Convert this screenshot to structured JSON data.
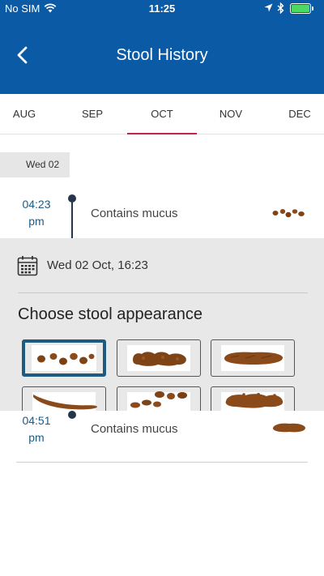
{
  "status": {
    "carrier": "No SIM",
    "time": "11:25"
  },
  "header": {
    "title": "Stool History"
  },
  "tabs": [
    {
      "label": "AUG"
    },
    {
      "label": "SEP"
    },
    {
      "label": "OCT",
      "active": true
    },
    {
      "label": "NOV"
    },
    {
      "label": "DEC"
    }
  ],
  "day_label": "Wed 02",
  "entries": [
    {
      "time_hm": "04:23",
      "time_ampm": "pm",
      "label": "Contains mucus"
    },
    {
      "time_hm": "04:51",
      "time_ampm": "pm",
      "label": "Contains mucus"
    }
  ],
  "detail": {
    "date": "Wed 02 Oct, 16:23",
    "choose_title": "Choose stool appearance"
  },
  "colors": {
    "header": "#0a5aa5",
    "tab_accent": "#c4244a",
    "selected_border": "#1f5a80",
    "stool": "#8a4a1a"
  }
}
